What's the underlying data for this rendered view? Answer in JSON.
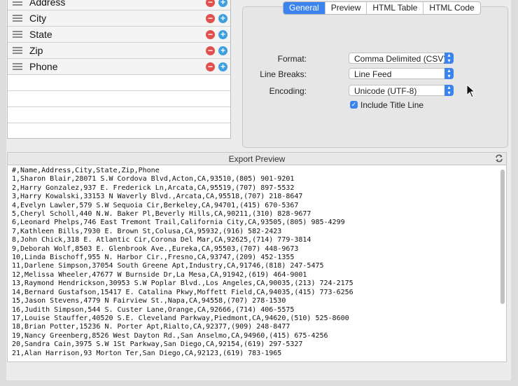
{
  "field_list": {
    "fields": [
      {
        "label": "Address"
      },
      {
        "label": "City"
      },
      {
        "label": "State"
      },
      {
        "label": "Zip"
      },
      {
        "label": "Phone"
      }
    ]
  },
  "tabs": [
    {
      "label": "General",
      "active": true
    },
    {
      "label": "Preview",
      "active": false
    },
    {
      "label": "HTML Table",
      "active": false
    },
    {
      "label": "HTML Code",
      "active": false
    }
  ],
  "form": {
    "format": {
      "label": "Format:",
      "value": "Comma Delimited (CSV)"
    },
    "line_breaks": {
      "label": "Line Breaks:",
      "value": "Line Feed"
    },
    "encoding": {
      "label": "Encoding:",
      "value": "Unicode (UTF-8)"
    },
    "include_title": {
      "label": "Include Title Line",
      "checked": true
    }
  },
  "preview": {
    "title": "Export Preview",
    "lines": [
      "#,Name,Address,City,State,Zip,Phone",
      "1,Sharon Blair,28071 S.W Cordova Blvd,Acton,CA,93510,(805) 901-9201",
      "2,Harry Gonzalez,937 E. Frederick Ln,Arcata,CA,95519,(707) 897-5532",
      "3,Harry Kowalski,33153 N Waverly Blvd.,Arcata,CA,95518,(707) 218-8647",
      "4,Evelyn Lawler,579 S.W Sequoia Cir,Berkeley,CA,94701,(415) 670-5367",
      "5,Cheryl Scholl,440 N.W. Baker Pl,Beverly Hills,CA,90211,(310) 828-9677",
      "6,Leonard Phelps,746 East Tremont Trail,California City,CA,93505,(805) 985-4299",
      "7,Kathleen Bills,7930 E. Brown St,Colusa,CA,95932,(916) 582-2423",
      "8,John Chick,318 E. Atlantic Cir,Corona Del Mar,CA,92625,(714) 779-3814",
      "9,Deborah Wolf,8503 E. Glenbrook Ave.,Eureka,CA,95503,(707) 448-9673",
      "10,Linda Bischoff,955 N. Harbor Cir.,Fresno,CA,93747,(209) 452-1355",
      "11,Darlene Simpson,37054 South Greene Apt,Industry,CA,91746,(818) 247-5475",
      "12,Melissa Wheeler,47677 W Burnside Dr,La Mesa,CA,91942,(619) 464-9001",
      "13,Raymond Hendrickson,30953 S.W Poplar Blvd.,Los Angeles,CA,90035,(213) 724-2175",
      "14,Bernard Gustafson,15417 E. Catalina Pkwy,Moffett Field,CA,94035,(415) 773-6256",
      "15,Jason Stevens,4779 N Fairview St.,Napa,CA,94558,(707) 278-1530",
      "16,Judith Simpson,544 S. Custer Lane,Orange,CA,92666,(714) 406-5575",
      "17,Louise Stauffer,40520 S.E. Cleveland Parkway,Piedmont,CA,94620,(510) 525-8600",
      "18,Brian Potter,15236 N. Porter Apt,Rialto,CA,92377,(909) 248-8477",
      "19,Nancy Greenberg,8526 West Dayton Rd.,San Anselmo,CA,94960,(415) 675-4256",
      "20,Sandra Cain,3975 S.W 1St Parkway,San Diego,CA,92154,(619) 297-5327",
      "21,Alan Harrison,93 Morton Ter,San Diego,CA,92123,(619) 783-1965"
    ]
  },
  "colors": {
    "accent": "#3b84f0",
    "remove": "#e0504c",
    "add": "#3d9ee0"
  }
}
